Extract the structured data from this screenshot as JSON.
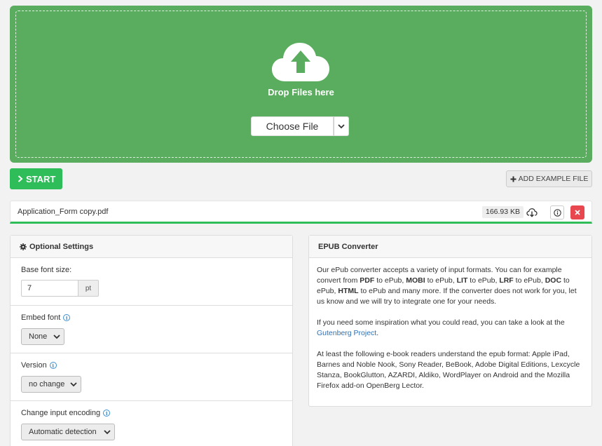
{
  "upload": {
    "drop_text": "Drop Files here",
    "choose_label": "Choose File"
  },
  "actions": {
    "start_label": "START",
    "example_label": "ADD EXAMPLE FILE"
  },
  "file": {
    "name": "Application_Form copy.pdf",
    "size": "166.93 KB"
  },
  "settings": {
    "title": "Optional Settings",
    "base_font": {
      "label": "Base font size:",
      "value": "7",
      "unit": "pt"
    },
    "embed_font": {
      "label": "Embed font",
      "value": "None"
    },
    "version": {
      "label": "Version",
      "value": "no change"
    },
    "encoding": {
      "label": "Change input encoding",
      "value": "Automatic detection"
    }
  },
  "epub": {
    "title": "EPUB Converter",
    "p1_a": "Our ePub converter accepts a variety of input formats. You can for example convert from ",
    "fmt_pdf": "PDF",
    "to1": " to ePub, ",
    "fmt_mobi": "MOBI",
    "to2": " to ePub, ",
    "fmt_lit": "LIT",
    "to3": " to ePub, ",
    "fmt_lrf": "LRF",
    "to4": " to ePub, ",
    "fmt_doc": "DOC",
    "to5": " to ePub, ",
    "fmt_html": "HTML",
    "p1_b": " to ePub and many more. If the converter does not work for you, let us know and we will try to integrate one for your needs.",
    "p2_a": "If you need some inspiration what you could read, you can take a look at the ",
    "p2_link": "Gutenberg Project",
    "p2_b": ".",
    "p3": "At least the following e-book readers understand the epub format: Apple iPad, Barnes and Noble Nook, Sony Reader, BeBook, Adobe Digital Editions, Lexcycle Stanza, BookGlutton, AZARDI, Aldiko, WordPlayer on Android and the Mozilla Firefox add-on OpenBerg Lector."
  },
  "colors": {
    "dropzone": "#5aac5e",
    "start": "#2ebd59",
    "delete": "#e8474f",
    "link": "#2d72b8"
  }
}
